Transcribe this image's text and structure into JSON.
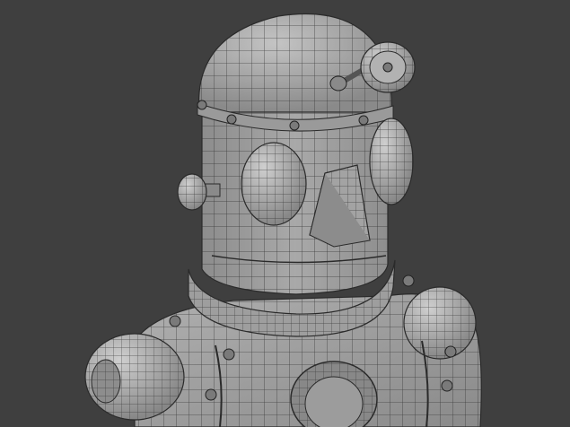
{
  "viewport": {
    "background_color": "#3f3f3f",
    "model_fill_color": "#a8a8a8",
    "wireframe_color": "#2e2e2e",
    "subject": "retro-toy-robot-wireframe-mesh"
  }
}
